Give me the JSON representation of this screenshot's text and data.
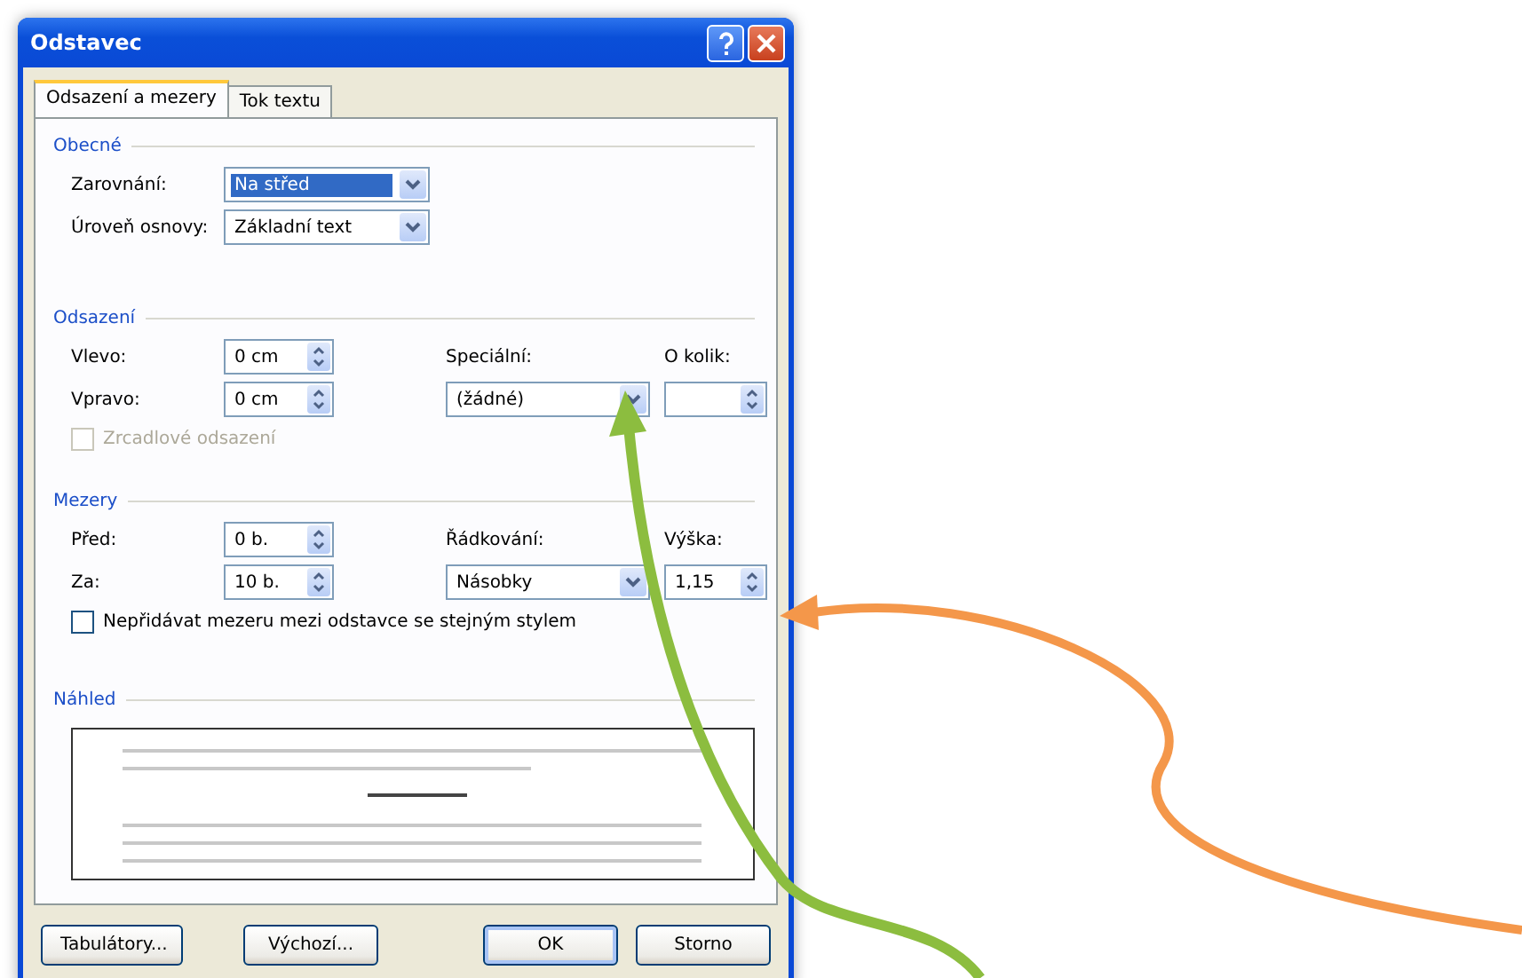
{
  "window": {
    "title": "Odstavec"
  },
  "tabs": [
    {
      "label": "Odsazení a mezery",
      "selected": true
    },
    {
      "label": "Tok textu",
      "selected": false
    }
  ],
  "sections": [
    {
      "title": "Obecné",
      "rows": [
        {
          "label": "Zarovnání:",
          "field": {
            "kind": "dropdown",
            "value": "Na střed",
            "highlighted": true
          }
        },
        {
          "label": "Úroveň osnovy:",
          "field": {
            "kind": "dropdown",
            "value": "Základní text",
            "highlighted": false
          }
        }
      ]
    },
    {
      "title": "Odsazení",
      "rows": [
        {
          "label": "Vlevo:",
          "field": {
            "kind": "spinner",
            "value": "0 cm",
            "highlighted": false
          },
          "heading": "Speciální:",
          "heading2": "O kolik:"
        },
        {
          "label": "Vpravo:",
          "field": {
            "kind": "spinner",
            "value": "0 cm",
            "highlighted": false
          },
          "field2": {
            "kind": "dropdown",
            "value": "(žádné)",
            "highlighted": false
          },
          "field3": {
            "kind": "spinner",
            "highlighted": false
          }
        }
      ],
      "checkbox": {
        "label": "Zrcadlové odsazení",
        "checked": false,
        "disabled": true
      }
    },
    {
      "title": "Mezery",
      "rows": [
        {
          "label": "Před:",
          "field": {
            "kind": "spinner",
            "value": "0 b.",
            "highlighted": false
          },
          "heading": "Řádkování:",
          "heading2": "Výška:"
        },
        {
          "label": "Za:",
          "field": {
            "kind": "spinner",
            "value": "10 b.",
            "highlighted": false
          },
          "field2": {
            "kind": "dropdown",
            "value": "Násobky",
            "highlighted": false
          },
          "field3": {
            "kind": "spinner",
            "value": "1,15",
            "highlighted": false
          }
        }
      ],
      "checkbox": {
        "label": "Nepřidávat mezeru mezi odstavce se stejným stylem",
        "checked": false,
        "disabled": false
      }
    }
  ],
  "preview": {
    "title": "Náhled"
  },
  "buttons": [
    {
      "label": "Tabulátory...",
      "default": false
    },
    {
      "label": "Výchozí...",
      "default": false
    },
    {
      "label": "OK",
      "default": true
    },
    {
      "label": "Storno",
      "default": false
    }
  ]
}
